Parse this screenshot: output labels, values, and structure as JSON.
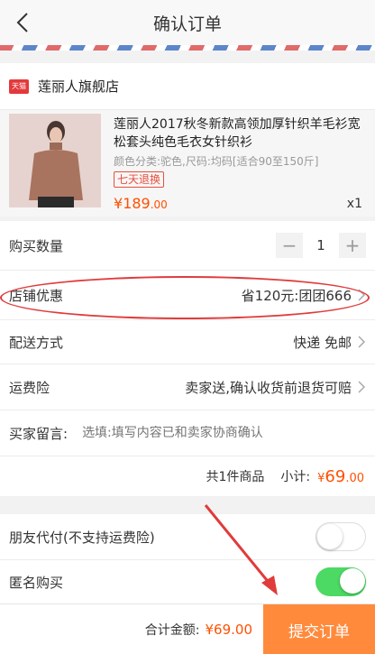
{
  "header": {
    "title": "确认订单"
  },
  "shop": {
    "badge": "天猫",
    "name": "莲丽人旗舰店"
  },
  "product": {
    "title": "莲丽人2017秋冬新款高领加厚针织羊毛衫宽松套头纯色毛衣女针织衫",
    "spec": "颜色分类:驼色,尺码:均码[适合90至150斤]",
    "tag": "七天退换",
    "price_symbol": "¥",
    "price_int": "189",
    "price_dec": ".00",
    "qty": "x1"
  },
  "quantity": {
    "label": "购买数量",
    "minus": "−",
    "value": "1",
    "plus": "+"
  },
  "discount": {
    "label": "店铺优惠",
    "value": "省120元:团团666"
  },
  "shipping": {
    "label": "配送方式",
    "value": "快递 免邮"
  },
  "insurance": {
    "label": "运费险",
    "value": "卖家送,确认收货前退货可赔"
  },
  "message": {
    "label": "买家留言:",
    "placeholder": "选填:填写内容已和卖家协商确认"
  },
  "subtotal": {
    "count_label": "共1件商品",
    "label": "小计:",
    "symbol": "¥",
    "int": "69",
    "dec": ".00"
  },
  "friend_pay": {
    "label": "朋友代付(不支持运费险)",
    "enabled": false
  },
  "anonymous": {
    "label": "匿名购买",
    "enabled": true
  },
  "footer": {
    "total_label": "合计金额:",
    "total_value": "¥69.00",
    "submit": "提交订单"
  },
  "colors": {
    "accent": "#ff5000",
    "submit_bg": "#ff8a3c",
    "toggle_on": "#4cd964",
    "annotation": "#e03b3b"
  }
}
